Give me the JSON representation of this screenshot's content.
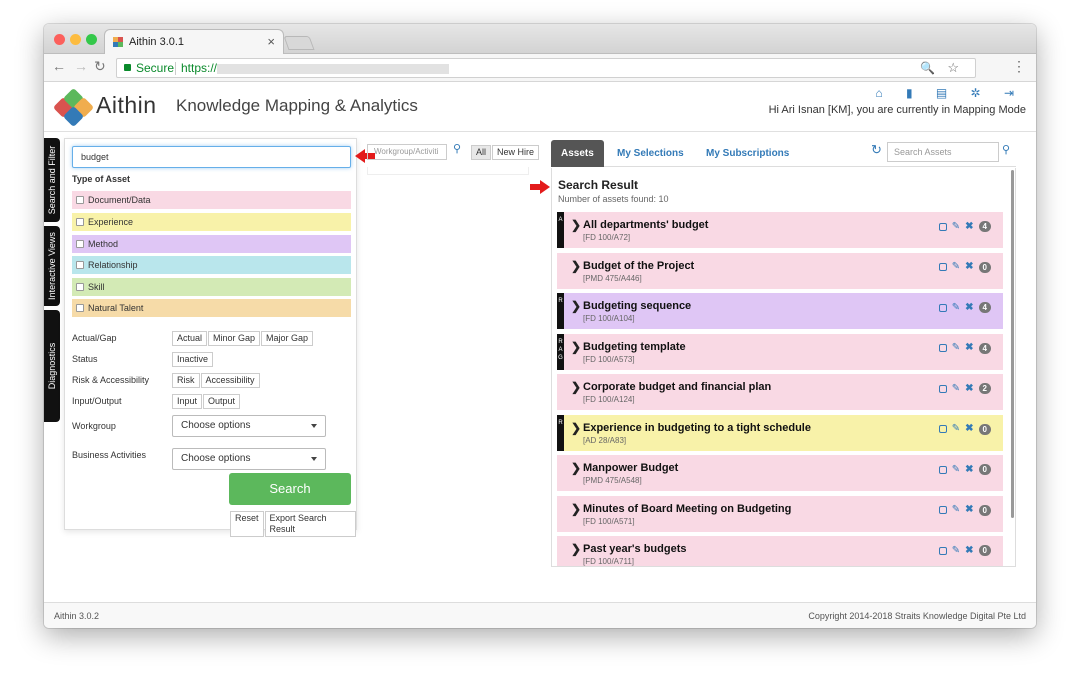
{
  "browser": {
    "tab_title": "Aithin 3.0.1",
    "tab_close": "×",
    "secure_label": "Secure",
    "url_protocol": "https://",
    "back_icon": "←",
    "forward_icon": "→",
    "reload_icon": "↻",
    "zoom_icon": "🔍",
    "bookmark_icon": "☆",
    "menu_icon": "⋮"
  },
  "app": {
    "brand": "Aithin",
    "title": "Knowledge Mapping & Analytics",
    "greeting": "Hi Ari Isnan [KM], you are currently in Mapping Mode",
    "header_icons": [
      "home-icon",
      "chart-icon",
      "book-icon",
      "gear-icon",
      "logout-icon"
    ],
    "header_icon_glyphs": "⌂ ▮ ▤ ✲ ⇥"
  },
  "side_tabs": [
    "Search and Filter",
    "Interactive Views",
    "Diagnostics"
  ],
  "filter": {
    "search_value": "budget",
    "type_heading": "Type of Asset",
    "asset_types": [
      {
        "label": "Document/Data",
        "color": "#f9d9e4"
      },
      {
        "label": "Experience",
        "color": "#f8f2a9"
      },
      {
        "label": "Method",
        "color": "#dfc6f5"
      },
      {
        "label": "Relationship",
        "color": "#b9e6ec"
      },
      {
        "label": "Skill",
        "color": "#d3eab5"
      },
      {
        "label": "Natural Talent",
        "color": "#f6dba8"
      }
    ],
    "actual_gap_label": "Actual/Gap",
    "actual_gap_buttons": [
      "Actual",
      "Minor Gap",
      "Major Gap"
    ],
    "status_label": "Status",
    "status_buttons": [
      "Inactive"
    ],
    "risk_label": "Risk & Accessibility",
    "risk_buttons": [
      "Risk",
      "Accessibility"
    ],
    "io_label": "Input/Output",
    "io_buttons": [
      "Input",
      "Output"
    ],
    "workgroup_label": "Workgroup",
    "workgroup_value": "Choose options",
    "business_label": "Business Activities",
    "business_value": "Choose options",
    "search_button": "Search",
    "reset_button": "Reset",
    "export_button": "Export Search Result"
  },
  "middle": {
    "workgroup_placeholder": "Workgroup/Activiti",
    "all_button": "All",
    "new_hire_button": "New Hire"
  },
  "results": {
    "tabs": [
      "Assets",
      "My Selections",
      "My Subscriptions"
    ],
    "search_placeholder": "Search Assets",
    "heading": "Search Result",
    "count_text": "Number of assets found: 10",
    "items": [
      {
        "title": "All departments' budget",
        "code": "[FD 100/A72]",
        "count": "4",
        "strip": "A",
        "color": "#f9d9e4"
      },
      {
        "title": "Budget of the Project",
        "code": "[PMD 475/A446]",
        "count": "0",
        "strip": "",
        "color": "#f9d9e4"
      },
      {
        "title": "Budgeting sequence",
        "code": "[FD 100/A104]",
        "count": "4",
        "strip": "R",
        "color": "#dfc6f5"
      },
      {
        "title": "Budgeting template",
        "code": "[FD 100/A573]",
        "count": "4",
        "strip": "R A G",
        "color": "#f9d9e4"
      },
      {
        "title": "Corporate budget and financial plan",
        "code": "[FD 100/A124]",
        "count": "2",
        "strip": "",
        "color": "#f9d9e4"
      },
      {
        "title": "Experience in budgeting to a tight schedule",
        "code": "[AD 28/A83]",
        "count": "0",
        "strip": "R",
        "color": "#f8f2a9"
      },
      {
        "title": "Manpower Budget",
        "code": "[PMD 475/A548]",
        "count": "0",
        "strip": "",
        "color": "#f9d9e4"
      },
      {
        "title": "Minutes of Board Meeting on Budgeting",
        "code": "[FD 100/A571]",
        "count": "0",
        "strip": "",
        "color": "#f9d9e4"
      },
      {
        "title": "Past year's budgets",
        "code": "[FD 100/A711]",
        "count": "0",
        "strip": "",
        "color": "#f9d9e4"
      }
    ]
  },
  "footer": {
    "version": "Aithin 3.0.2",
    "copyright": "Copyright 2014-2018 Straits Knowledge Digital Pte Ltd"
  }
}
